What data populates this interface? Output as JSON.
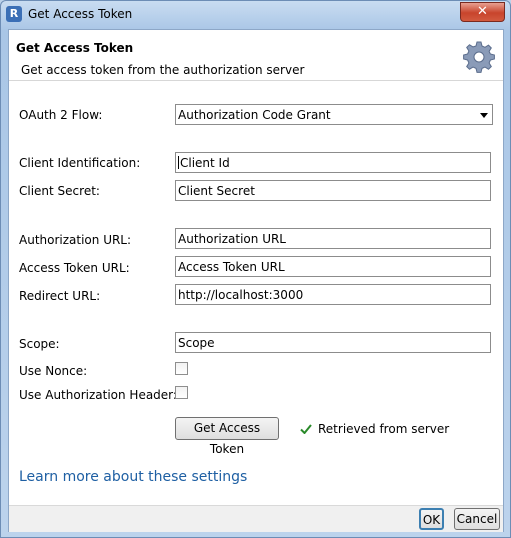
{
  "window": {
    "title": "Get Access Token",
    "app_icon_glyph": "R",
    "close_glyph": "✕"
  },
  "header": {
    "title": "Get Access Token",
    "subtitle": "Get access token from the authorization server",
    "icon": "gear-icon"
  },
  "form": {
    "flow_label": "OAuth 2 Flow:",
    "flow_value": "Authorization Code Grant",
    "client_id_label": "Client Identification:",
    "client_id_value": "Client Id",
    "client_secret_label": "Client Secret:",
    "client_secret_value": "Client Secret",
    "auth_url_label": "Authorization URL:",
    "auth_url_value": "Authorization URL",
    "token_url_label": "Access Token URL:",
    "token_url_value": "Access Token URL",
    "redirect_url_label": "Redirect URL:",
    "redirect_url_value": "http://localhost:3000",
    "scope_label": "Scope:",
    "scope_value": "Scope",
    "nonce_label": "Use Nonce:",
    "nonce_checked": false,
    "auth_header_label": "Use Authorization Header:",
    "auth_header_checked": false
  },
  "actions": {
    "get_token_label": "Get Access Token",
    "status_text": "Retrieved from server",
    "status_color": "#2a8a2a",
    "learn_more": "Learn more about these settings",
    "link_color": "#1e5fa3"
  },
  "footer": {
    "ok_label": "OK",
    "cancel_label": "Cancel"
  }
}
